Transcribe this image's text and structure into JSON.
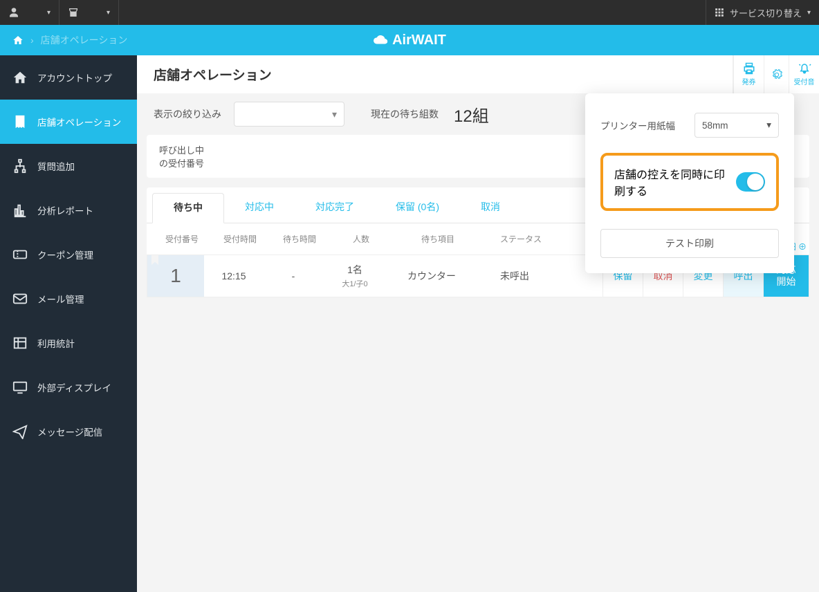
{
  "topbar": {
    "service_switch": "サービス切り替え"
  },
  "breadcrumb": {
    "current": "店舗オペレーション"
  },
  "brand": "AirWAIT",
  "sidebar": {
    "items": [
      {
        "label": "アカウントトップ"
      },
      {
        "label": "店舗オペレーション"
      },
      {
        "label": "質問追加"
      },
      {
        "label": "分析レポート"
      },
      {
        "label": "クーポン管理"
      },
      {
        "label": "メール管理"
      },
      {
        "label": "利用統計"
      },
      {
        "label": "外部ディスプレイ"
      },
      {
        "label": "メッセージ配信"
      }
    ]
  },
  "header": {
    "title": "店舗オペレーション",
    "icons": {
      "ticket": "発券",
      "sound": "受付音"
    }
  },
  "filter": {
    "label": "表示の絞り込み",
    "wait_label": "現在の待ち組数",
    "wait_count": "12組"
  },
  "calling": {
    "line1": "呼び出し中",
    "line2": "の受付番号"
  },
  "tabs": [
    {
      "label": "待ち中"
    },
    {
      "label": "対応中"
    },
    {
      "label": "対応完了"
    },
    {
      "label": "保留 (0名)"
    },
    {
      "label": "取消"
    }
  ],
  "columns": {
    "c1": "受付番号",
    "c2": "受付時間",
    "c3": "待ち時間",
    "c4": "人数",
    "c5": "待ち項目",
    "c6": "ステータス"
  },
  "row": {
    "num": "1",
    "time": "12:15",
    "wait": "-",
    "persons": "1名",
    "persons_sub": "大1/子0",
    "item": "カウンター",
    "status": "未呼出",
    "actions": {
      "hold": "保留",
      "cancel": "取消",
      "change": "変更",
      "call": "呼出",
      "start": "対応\n開始"
    }
  },
  "detail_link": "詳細",
  "popover": {
    "paper_label": "プリンター用紙幅",
    "paper_value": "58mm",
    "print_copy_label": "店舗の控えを同時に印刷する",
    "test_print": "テスト印刷"
  }
}
